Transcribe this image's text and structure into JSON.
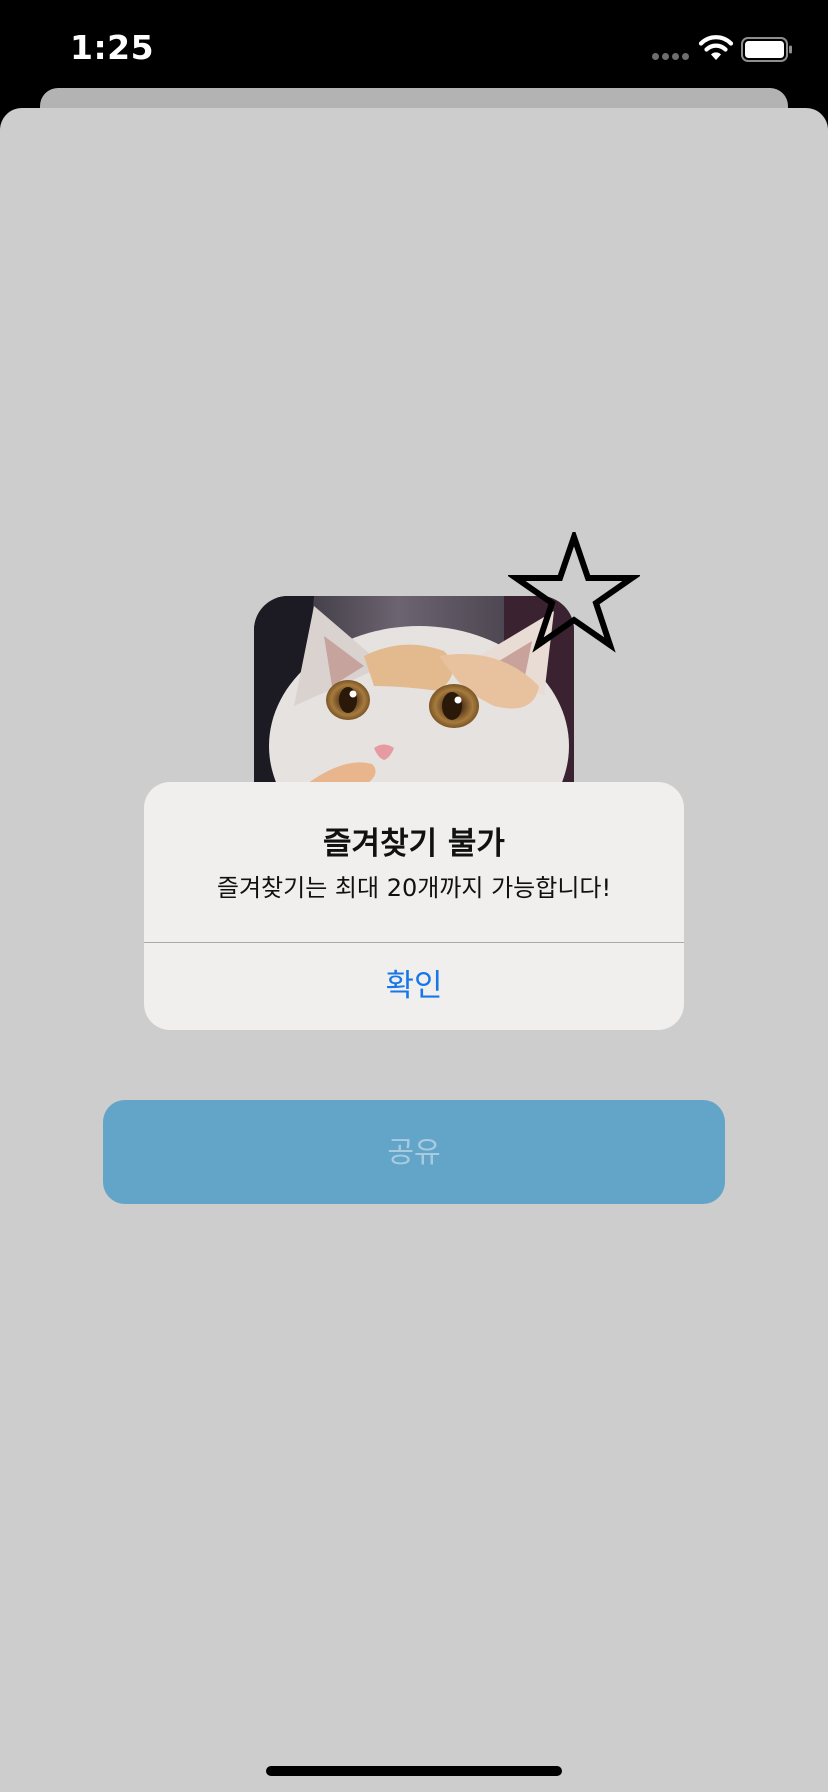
{
  "status_bar": {
    "time": "1:25"
  },
  "alert": {
    "title": "즐겨찾기 불가",
    "message": "즐겨찾기는 최대 20개까지 가능합니다!",
    "ok_label": "확인"
  },
  "share_button": {
    "label": "공유"
  },
  "colors": {
    "alert_button": "#1777ea",
    "share_button_bg": "#63a5c9",
    "sheet_bg": "#cdcdcd"
  }
}
